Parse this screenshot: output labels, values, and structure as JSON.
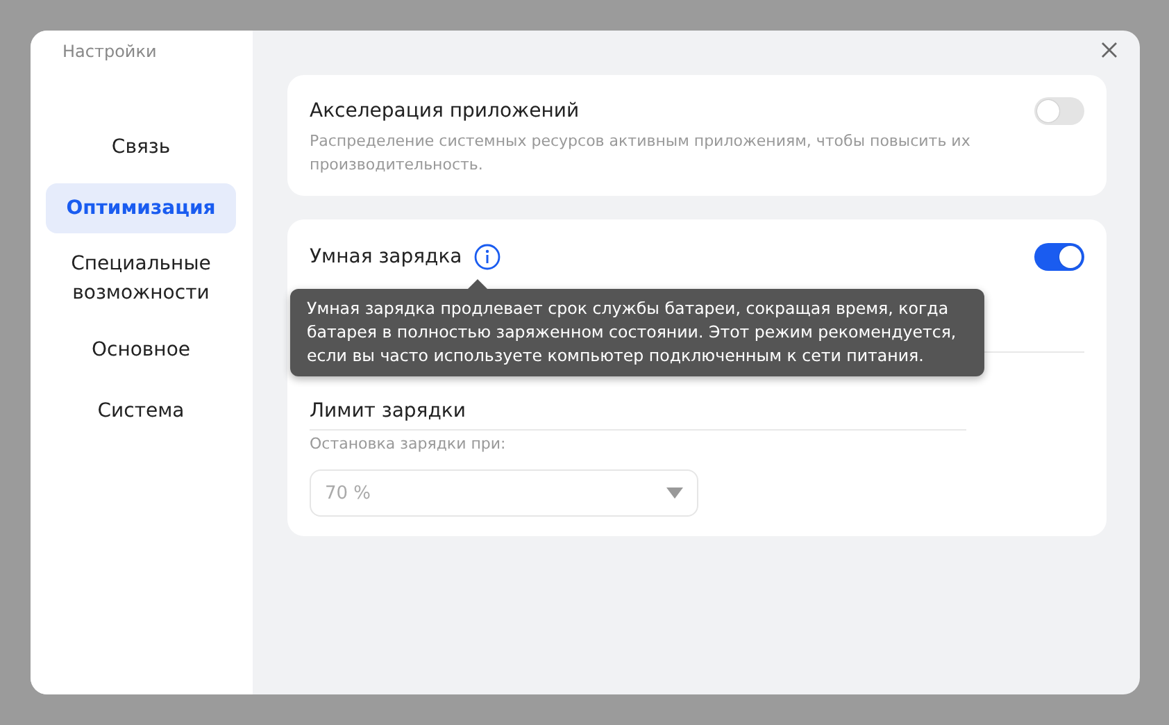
{
  "window": {
    "title": "Настройки"
  },
  "sidebar": {
    "items": [
      {
        "label": "Связь",
        "selected": false
      },
      {
        "label": "Оптимизация",
        "selected": true
      },
      {
        "label": "Специальные возможности",
        "selected": false
      },
      {
        "label": "Основное",
        "selected": false
      },
      {
        "label": "Система",
        "selected": false
      }
    ]
  },
  "app_acceleration": {
    "title": "Акселерация приложений",
    "description": "Распределение системных ресурсов активным приложениям, чтобы повысить их производительность.",
    "on": false
  },
  "smart_charging": {
    "title": "Умная зарядка",
    "on": true,
    "tooltip": "Умная зарядка продлевает срок службы батареи, сокращая время, когда батарея в полностью заряженном состоянии. Этот режим рекомендуется, если вы часто используете компьютер подключенным к сети питания.",
    "limit_title": "Лимит зарядки",
    "limit_label": "Остановка зарядки при:",
    "limit_value": "70 %",
    "limit_disabled": true
  }
}
